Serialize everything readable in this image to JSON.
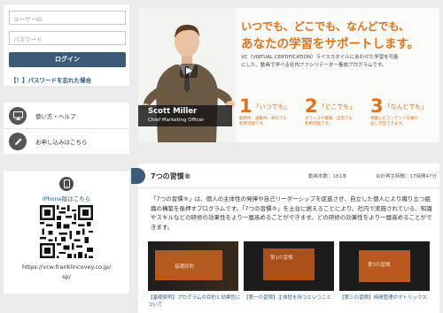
{
  "login": {
    "user_placeholder": "ユーザーID",
    "pass_placeholder": "パスワード",
    "login_label": "ログイン",
    "forgot_label": "【！】パスワードを忘れた場合"
  },
  "help": {
    "items": [
      {
        "label": "使い方・ヘルプ",
        "icon": "monitor-icon"
      },
      {
        "label": "お申し込みはこちら",
        "icon": "pencil-icon"
      }
    ]
  },
  "iphone": {
    "label": "iPhone版はこちら",
    "url_line1": "https://vcw.franklincovey.co.jp/",
    "url_line2": "sp/"
  },
  "hero": {
    "headline1": "いつでも、どこでも、なんどでも、",
    "headline2": "あなたの学習をサポートします。",
    "desc1": "VC（VIRTUAL CERTIFICATION）ライススタイルにあわせた学習を可能",
    "desc2": "にした、動画で学べる社内ファシリテーター養成プログラムです。",
    "features": [
      {
        "num": "1",
        "title": "「いつでも」",
        "desc": "勤務中、通勤中、休日でも利用可能です。"
      },
      {
        "num": "2",
        "title": "「どこでも」",
        "desc": "オフィスや電車、自宅でも利用可能です。"
      },
      {
        "num": "3",
        "title": "「なんどでも」",
        "desc": "視聴したコンテンツを繰り返し学習できます。"
      }
    ],
    "person_name": "Scott Miller",
    "person_title": "Chief Marketing Officer",
    "accent": "#e0721d"
  },
  "course": {
    "title": "7つの習慣®",
    "video_count": "動画本数：161本",
    "total_time": "合計再生時間：17時間47分",
    "description": "「7つの習慣®」は、個人の主体性の発揮や自己リーダーシップを促進させ、自立した個人により織り立つ組織の構築を後押すプログラムです。「7つの習慣®」を土台に据えることにより、社内で実施されている、知識やスキルなどの研修の効果性をより一層高めることができます。どの研修の効果性をより一層高めることができます。",
    "videos": [
      {
        "thumb_title": "基礎原則",
        "caption": "【基礎原則】プログラムの目的と効果性について"
      },
      {
        "thumb_title": "第1の習慣",
        "caption": "【第一の習慣】主体性を持つということ"
      },
      {
        "thumb_title": "第3の習慣",
        "caption": "【第三の習慣】時間管理のマトリックス"
      }
    ]
  }
}
